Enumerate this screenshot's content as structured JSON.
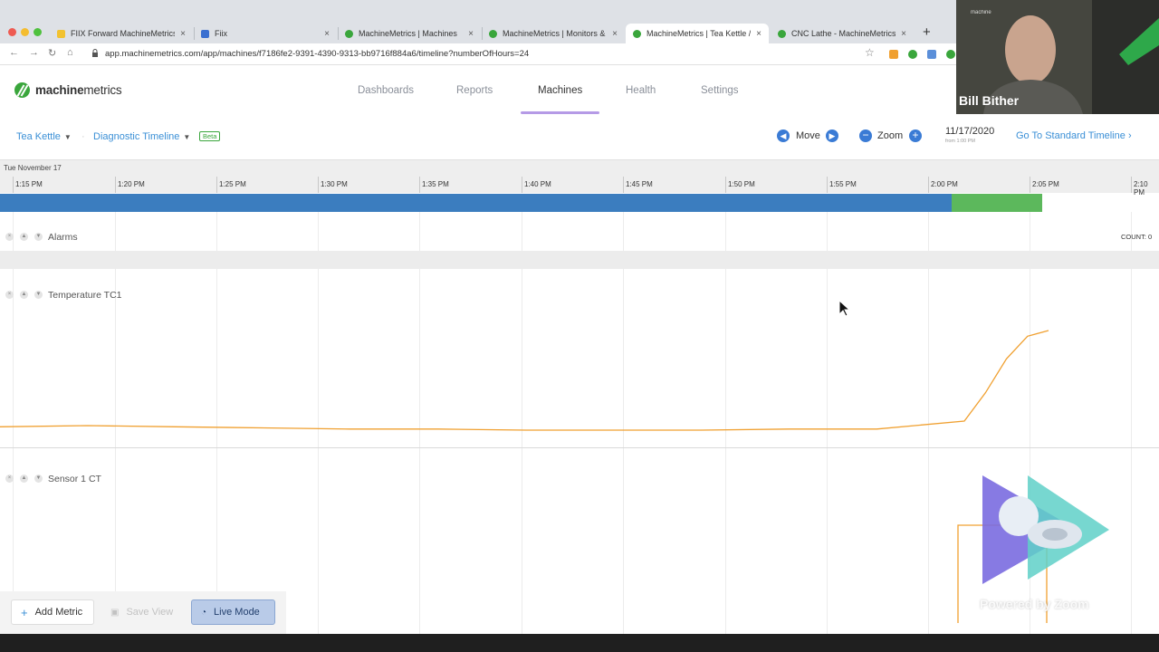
{
  "browser": {
    "tabs": [
      {
        "label": "FIIX Forward MachineMetrics",
        "favicon_color": "#f2c230"
      },
      {
        "label": "Fiix",
        "favicon_color": "#3a6fd0"
      },
      {
        "label": "MachineMetrics | Machines",
        "favicon_color": "#3aa63c"
      },
      {
        "label": "MachineMetrics | Monitors & N",
        "favicon_color": "#3aa63c"
      },
      {
        "label": "MachineMetrics | Tea Kettle /",
        "favicon_color": "#3aa63c"
      },
      {
        "label": "CNC Lathe - MachineMetrics",
        "favicon_color": "#3aa63c"
      }
    ],
    "close_glyph": "×",
    "new_tab_glyph": "+",
    "url": "app.machinemetrics.com/app/machines/f7186fe2-9391-4390-9313-bb9716f884a6/timeline?numberOfHours=24"
  },
  "app": {
    "logo_bold": "machine",
    "logo_light": "metrics",
    "nav": [
      "Dashboards",
      "Reports",
      "Machines",
      "Health",
      "Settings"
    ],
    "active_nav": "Machines",
    "accent": "#3a8fd6"
  },
  "toolbar": {
    "machine": "Tea Kettle",
    "view": "Diagnostic Timeline",
    "beta": "Beta",
    "move": "Move",
    "zoom": "Zoom",
    "date": "11/17/2020",
    "date_sub": "from 1:00 PM",
    "go_standard": "Go To Standard Timeline"
  },
  "timeline": {
    "day_label": "Tue November 17",
    "ticks": [
      "1:15 PM",
      "1:20 PM",
      "1:25 PM",
      "1:30 PM",
      "1:35 PM",
      "1:40 PM",
      "1:45 PM",
      "1:50 PM",
      "1:55 PM",
      "2:00 PM",
      "2:05 PM",
      "2:10 PM"
    ],
    "state_colors": {
      "active": "#3b7dbf",
      "green": "#5cb85c"
    },
    "rows": [
      {
        "label": "Alarms",
        "count": "COUNT: 0"
      },
      {
        "label": "Temperature TC1"
      },
      {
        "label": "Sensor 1 CT"
      }
    ]
  },
  "chart_data": {
    "type": "line",
    "series": [
      {
        "values": [
          0.15,
          0.16,
          0.15,
          0.14,
          0.13,
          0.13,
          0.12,
          0.12,
          0.12,
          0.13,
          0.13,
          0.2,
          0.45,
          0.75,
          0.95,
          1.0
        ]
      }
    ]
  },
  "actions": {
    "add_metric": "Add Metric",
    "save_view": "Save View",
    "live_mode": "Live Mode"
  },
  "overlay": {
    "presenter": "Bill Bither",
    "watermark": "Powered by Zoom"
  }
}
